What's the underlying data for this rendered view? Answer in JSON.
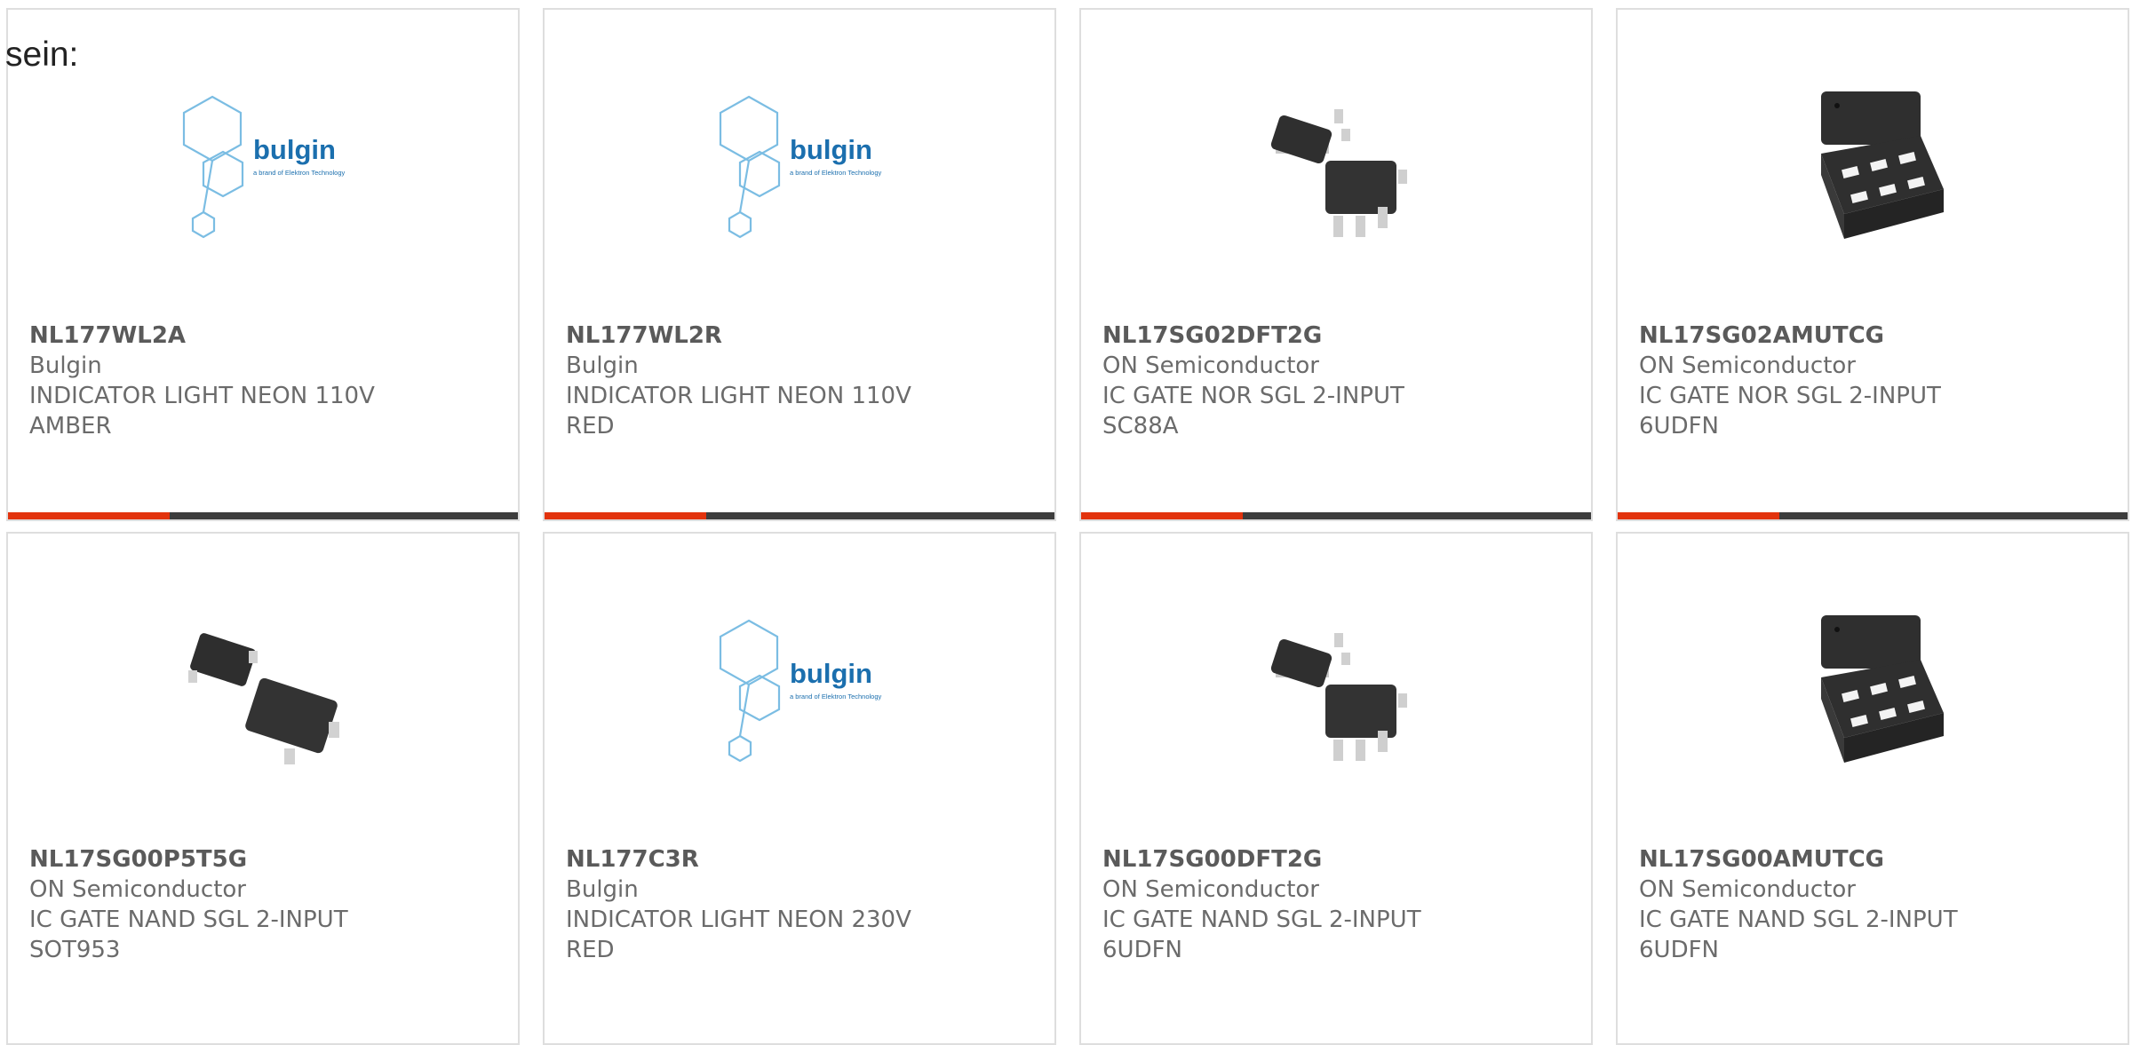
{
  "intro_text": "sein:",
  "colors": {
    "accent": "#e2330d",
    "bar_dark": "#3d3d3d",
    "card_border": "#dedede"
  },
  "products": [
    {
      "part_number": "NL177WL2A",
      "manufacturer": "Bulgin",
      "desc_line1": "INDICATOR LIGHT NEON 110V",
      "desc_line2": "AMBER",
      "image": "bulgin-logo",
      "logo_text": "bulgin",
      "logo_tag": "a brand of Elektron Technology"
    },
    {
      "part_number": "NL177WL2R",
      "manufacturer": "Bulgin",
      "desc_line1": "INDICATOR LIGHT NEON 110V",
      "desc_line2": "RED",
      "image": "bulgin-logo",
      "logo_text": "bulgin",
      "logo_tag": "a brand of Elektron Technology"
    },
    {
      "part_number": "NL17SG02DFT2G",
      "manufacturer": "ON Semiconductor",
      "desc_line1": "IC GATE NOR SGL 2-INPUT",
      "desc_line2": "SC88A",
      "image": "sc88a-package"
    },
    {
      "part_number": "NL17SG02AMUTCG",
      "manufacturer": "ON Semiconductor",
      "desc_line1": "IC GATE NOR SGL 2-INPUT",
      "desc_line2": "6UDFN",
      "image": "udfn-package"
    },
    {
      "part_number": "NL17SG00P5T5G",
      "manufacturer": "ON Semiconductor",
      "desc_line1": "IC GATE NAND SGL 2-INPUT",
      "desc_line2": "SOT953",
      "image": "sot953-package"
    },
    {
      "part_number": "NL177C3R",
      "manufacturer": "Bulgin",
      "desc_line1": "INDICATOR LIGHT NEON 230V",
      "desc_line2": "RED",
      "image": "bulgin-logo",
      "logo_text": "bulgin",
      "logo_tag": "a brand of Elektron Technology"
    },
    {
      "part_number": "NL17SG00DFT2G",
      "manufacturer": "ON Semiconductor",
      "desc_line1": "IC GATE NAND SGL 2-INPUT",
      "desc_line2": "6UDFN",
      "image": "sc88a-package"
    },
    {
      "part_number": "NL17SG00AMUTCG",
      "manufacturer": "ON Semiconductor",
      "desc_line1": "IC GATE NAND SGL 2-INPUT",
      "desc_line2": "6UDFN",
      "image": "udfn-package"
    }
  ]
}
